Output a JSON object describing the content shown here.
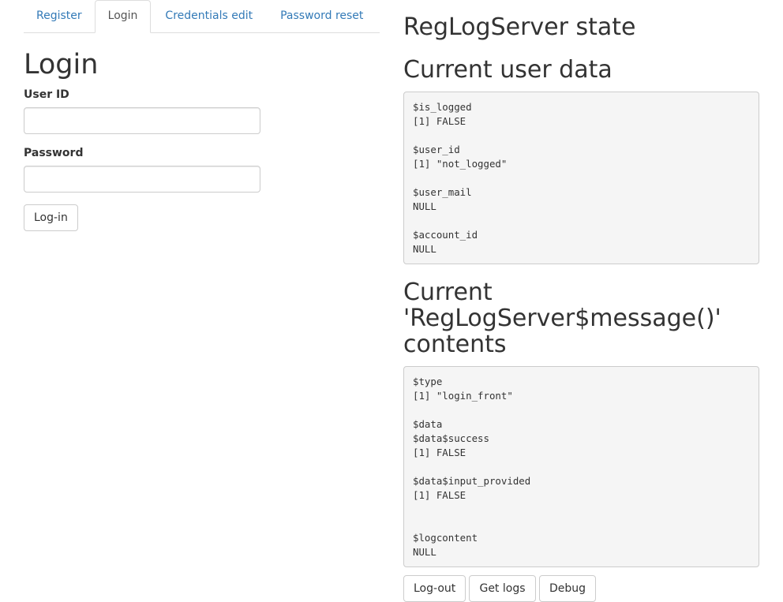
{
  "tabs": [
    {
      "label": "Register",
      "active": false
    },
    {
      "label": "Login",
      "active": true
    },
    {
      "label": "Credentials edit",
      "active": false
    },
    {
      "label": "Password reset",
      "active": false
    }
  ],
  "login": {
    "title": "Login",
    "user_id_label": "User ID",
    "user_id_value": "",
    "password_label": "Password",
    "password_value": "",
    "submit_label": "Log-in"
  },
  "state": {
    "title": "RegLogServer state",
    "user_data_title": "Current user data",
    "user_data_text": "$is_logged\n[1] FALSE\n\n$user_id\n[1] \"not_logged\"\n\n$user_mail\nNULL\n\n$account_id\nNULL",
    "message_title": "Current 'RegLogServer$message()' contents",
    "message_text": "$type\n[1] \"login_front\"\n\n$data\n$data$success\n[1] FALSE\n\n$data$input_provided\n[1] FALSE\n\n\n$logcontent\nNULL"
  },
  "actions": {
    "logout_label": "Log-out",
    "get_logs_label": "Get logs",
    "debug_label": "Debug"
  },
  "colors": {
    "link": "#337ab7",
    "text": "#333333",
    "pre_background": "#f5f5f5",
    "border": "#cccccc"
  }
}
